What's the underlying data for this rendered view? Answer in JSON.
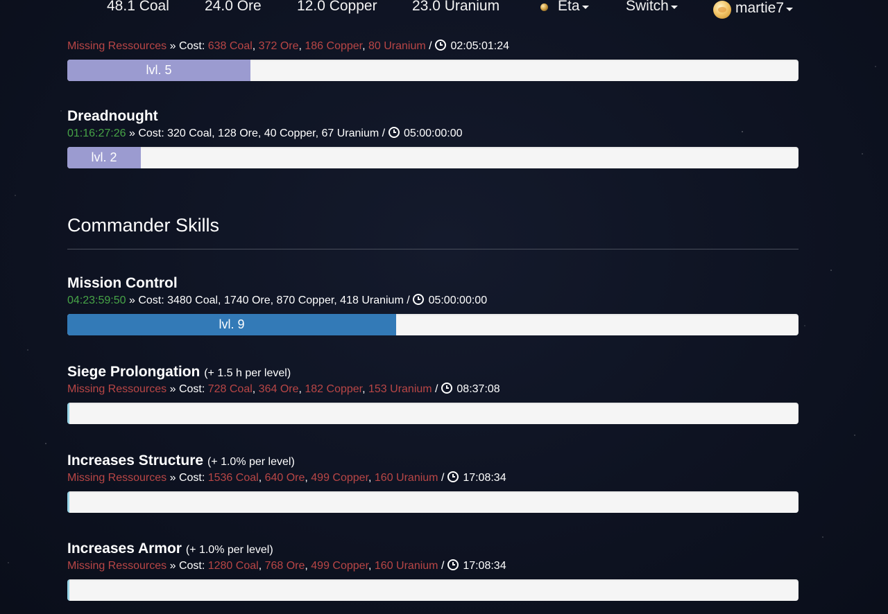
{
  "topbar": {
    "resources": [
      {
        "label": "48.1 Coal"
      },
      {
        "label": "24.0 Ore"
      },
      {
        "label": "12.0 Copper"
      },
      {
        "label": "23.0 Uranium"
      }
    ],
    "planet_menu": {
      "label": "Eta",
      "icon": "planet-icon"
    },
    "switch_menu": {
      "label": "Switch"
    },
    "user_menu": {
      "label": "martie7",
      "icon": "avatar"
    }
  },
  "top_skill": {
    "status": "Missing Ressources",
    "sep": " » Cost: ",
    "costs": [
      "638 Coal",
      "372 Ore",
      "186 Copper",
      "80 Uranium"
    ],
    "duration": "02:05:01:24",
    "level_label": "lvl. 5",
    "level_fraction": 0.25,
    "bar_color": "purple"
  },
  "dreadnought": {
    "title": "Dreadnought",
    "timer": "01:16:27:26",
    "cost_text": " » Cost: 320 Coal, 128 Ore, 40 Copper, 67 Uranium / ",
    "duration": "05:00:00:00",
    "level_label": "lvl. 2",
    "level_fraction": 0.1
  },
  "commander_section": {
    "title": "Commander Skills"
  },
  "mission_control": {
    "title": "Mission Control",
    "timer": "04:23:59:50",
    "cost_text": " » Cost: 3480 Coal, 1740 Ore, 870 Copper, 418 Uranium / ",
    "duration": "05:00:00:00",
    "level_label": "lvl. 9",
    "level_fraction": 0.45
  },
  "skills": [
    {
      "title": "Siege Prolongation",
      "bonus": "(+ 1.5 h per level)",
      "status": "Missing Ressources",
      "costs": [
        "728 Coal",
        "364 Ore",
        "182 Copper",
        "153 Uranium"
      ],
      "duration": "08:37:08",
      "level_fraction": 0
    },
    {
      "title": "Increases Structure",
      "bonus": "(+ 1.0% per level)",
      "status": "Missing Ressources",
      "costs": [
        "1536 Coal",
        "640 Ore",
        "499 Copper",
        "160 Uranium"
      ],
      "duration": "17:08:34",
      "level_fraction": 0
    },
    {
      "title": "Increases Armor",
      "bonus": "(+ 1.0% per level)",
      "status": "Missing Ressources",
      "costs": [
        "1280 Coal",
        "768 Ore",
        "499 Copper",
        "160 Uranium"
      ],
      "duration": "17:08:34",
      "level_fraction": 0
    }
  ],
  "colors": {
    "background": "#0e1322",
    "missing": "#b94646",
    "timer": "#47a447",
    "bar_purple": "#9b9bd0",
    "bar_blue": "#337ab7",
    "track": "#f5f5f5"
  }
}
